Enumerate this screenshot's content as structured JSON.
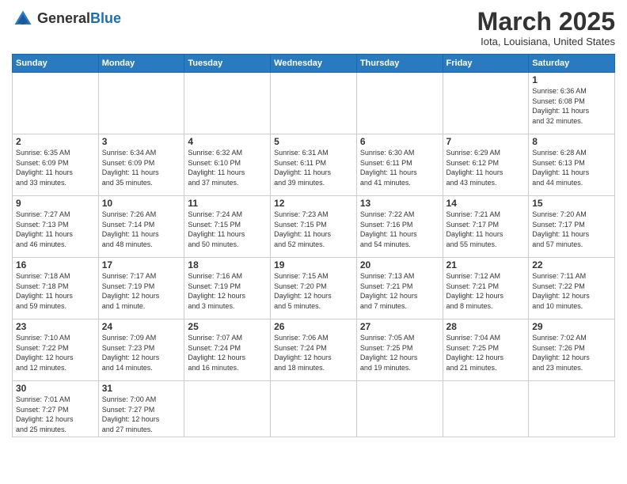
{
  "header": {
    "logo_general": "General",
    "logo_blue": "Blue",
    "month_title": "March 2025",
    "location": "Iota, Louisiana, United States"
  },
  "weekdays": [
    "Sunday",
    "Monday",
    "Tuesday",
    "Wednesday",
    "Thursday",
    "Friday",
    "Saturday"
  ],
  "weeks": [
    [
      {
        "day": "",
        "info": ""
      },
      {
        "day": "",
        "info": ""
      },
      {
        "day": "",
        "info": ""
      },
      {
        "day": "",
        "info": ""
      },
      {
        "day": "",
        "info": ""
      },
      {
        "day": "",
        "info": ""
      },
      {
        "day": "1",
        "info": "Sunrise: 6:36 AM\nSunset: 6:08 PM\nDaylight: 11 hours\nand 32 minutes."
      }
    ],
    [
      {
        "day": "2",
        "info": "Sunrise: 6:35 AM\nSunset: 6:09 PM\nDaylight: 11 hours\nand 33 minutes."
      },
      {
        "day": "3",
        "info": "Sunrise: 6:34 AM\nSunset: 6:09 PM\nDaylight: 11 hours\nand 35 minutes."
      },
      {
        "day": "4",
        "info": "Sunrise: 6:32 AM\nSunset: 6:10 PM\nDaylight: 11 hours\nand 37 minutes."
      },
      {
        "day": "5",
        "info": "Sunrise: 6:31 AM\nSunset: 6:11 PM\nDaylight: 11 hours\nand 39 minutes."
      },
      {
        "day": "6",
        "info": "Sunrise: 6:30 AM\nSunset: 6:11 PM\nDaylight: 11 hours\nand 41 minutes."
      },
      {
        "day": "7",
        "info": "Sunrise: 6:29 AM\nSunset: 6:12 PM\nDaylight: 11 hours\nand 43 minutes."
      },
      {
        "day": "8",
        "info": "Sunrise: 6:28 AM\nSunset: 6:13 PM\nDaylight: 11 hours\nand 44 minutes."
      }
    ],
    [
      {
        "day": "9",
        "info": "Sunrise: 7:27 AM\nSunset: 7:13 PM\nDaylight: 11 hours\nand 46 minutes."
      },
      {
        "day": "10",
        "info": "Sunrise: 7:26 AM\nSunset: 7:14 PM\nDaylight: 11 hours\nand 48 minutes."
      },
      {
        "day": "11",
        "info": "Sunrise: 7:24 AM\nSunset: 7:15 PM\nDaylight: 11 hours\nand 50 minutes."
      },
      {
        "day": "12",
        "info": "Sunrise: 7:23 AM\nSunset: 7:15 PM\nDaylight: 11 hours\nand 52 minutes."
      },
      {
        "day": "13",
        "info": "Sunrise: 7:22 AM\nSunset: 7:16 PM\nDaylight: 11 hours\nand 54 minutes."
      },
      {
        "day": "14",
        "info": "Sunrise: 7:21 AM\nSunset: 7:17 PM\nDaylight: 11 hours\nand 55 minutes."
      },
      {
        "day": "15",
        "info": "Sunrise: 7:20 AM\nSunset: 7:17 PM\nDaylight: 11 hours\nand 57 minutes."
      }
    ],
    [
      {
        "day": "16",
        "info": "Sunrise: 7:18 AM\nSunset: 7:18 PM\nDaylight: 11 hours\nand 59 minutes."
      },
      {
        "day": "17",
        "info": "Sunrise: 7:17 AM\nSunset: 7:19 PM\nDaylight: 12 hours\nand 1 minute."
      },
      {
        "day": "18",
        "info": "Sunrise: 7:16 AM\nSunset: 7:19 PM\nDaylight: 12 hours\nand 3 minutes."
      },
      {
        "day": "19",
        "info": "Sunrise: 7:15 AM\nSunset: 7:20 PM\nDaylight: 12 hours\nand 5 minutes."
      },
      {
        "day": "20",
        "info": "Sunrise: 7:13 AM\nSunset: 7:21 PM\nDaylight: 12 hours\nand 7 minutes."
      },
      {
        "day": "21",
        "info": "Sunrise: 7:12 AM\nSunset: 7:21 PM\nDaylight: 12 hours\nand 8 minutes."
      },
      {
        "day": "22",
        "info": "Sunrise: 7:11 AM\nSunset: 7:22 PM\nDaylight: 12 hours\nand 10 minutes."
      }
    ],
    [
      {
        "day": "23",
        "info": "Sunrise: 7:10 AM\nSunset: 7:22 PM\nDaylight: 12 hours\nand 12 minutes."
      },
      {
        "day": "24",
        "info": "Sunrise: 7:09 AM\nSunset: 7:23 PM\nDaylight: 12 hours\nand 14 minutes."
      },
      {
        "day": "25",
        "info": "Sunrise: 7:07 AM\nSunset: 7:24 PM\nDaylight: 12 hours\nand 16 minutes."
      },
      {
        "day": "26",
        "info": "Sunrise: 7:06 AM\nSunset: 7:24 PM\nDaylight: 12 hours\nand 18 minutes."
      },
      {
        "day": "27",
        "info": "Sunrise: 7:05 AM\nSunset: 7:25 PM\nDaylight: 12 hours\nand 19 minutes."
      },
      {
        "day": "28",
        "info": "Sunrise: 7:04 AM\nSunset: 7:25 PM\nDaylight: 12 hours\nand 21 minutes."
      },
      {
        "day": "29",
        "info": "Sunrise: 7:02 AM\nSunset: 7:26 PM\nDaylight: 12 hours\nand 23 minutes."
      }
    ],
    [
      {
        "day": "30",
        "info": "Sunrise: 7:01 AM\nSunset: 7:27 PM\nDaylight: 12 hours\nand 25 minutes."
      },
      {
        "day": "31",
        "info": "Sunrise: 7:00 AM\nSunset: 7:27 PM\nDaylight: 12 hours\nand 27 minutes."
      },
      {
        "day": "",
        "info": ""
      },
      {
        "day": "",
        "info": ""
      },
      {
        "day": "",
        "info": ""
      },
      {
        "day": "",
        "info": ""
      },
      {
        "day": "",
        "info": ""
      }
    ]
  ]
}
